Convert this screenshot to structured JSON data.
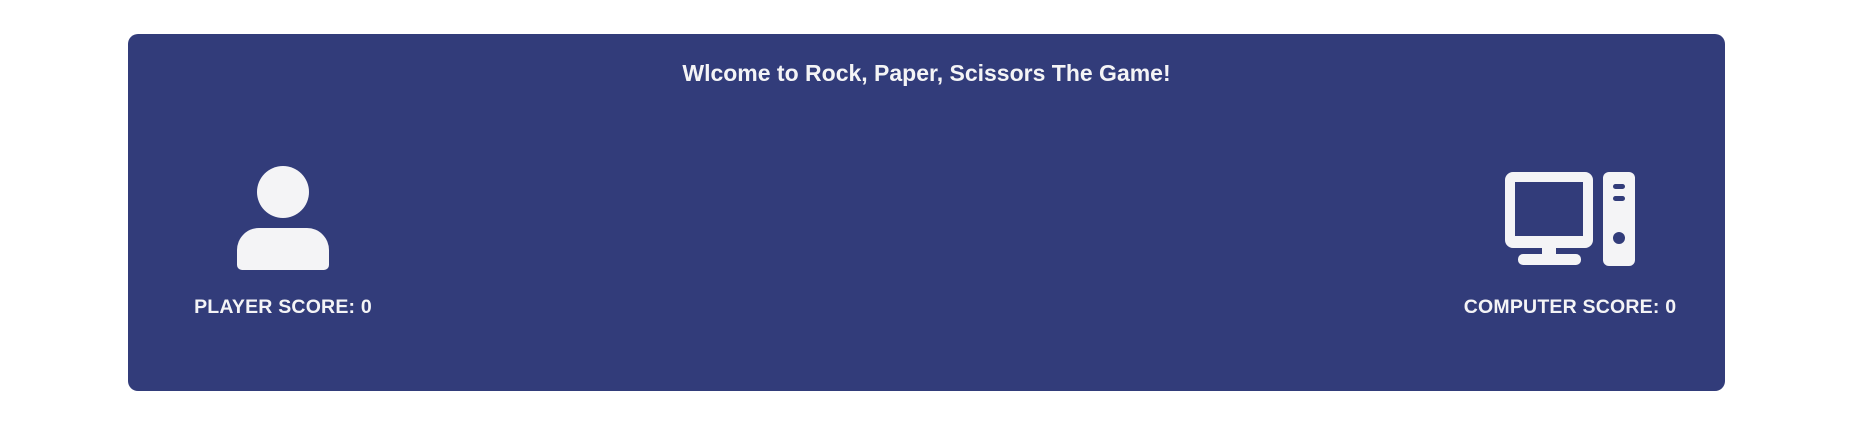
{
  "game": {
    "title": "Wlcome to Rock, Paper, Scissors The Game!",
    "player": {
      "icon": "user-icon",
      "score_label": "PLAYER SCORE: 0"
    },
    "computer": {
      "icon": "desktop-computer-icon",
      "score_label": "COMPUTER SCORE: 0"
    }
  },
  "colors": {
    "panel_background": "#323c7a",
    "text": "#f4f4f6",
    "page_background": "#ffffff"
  }
}
